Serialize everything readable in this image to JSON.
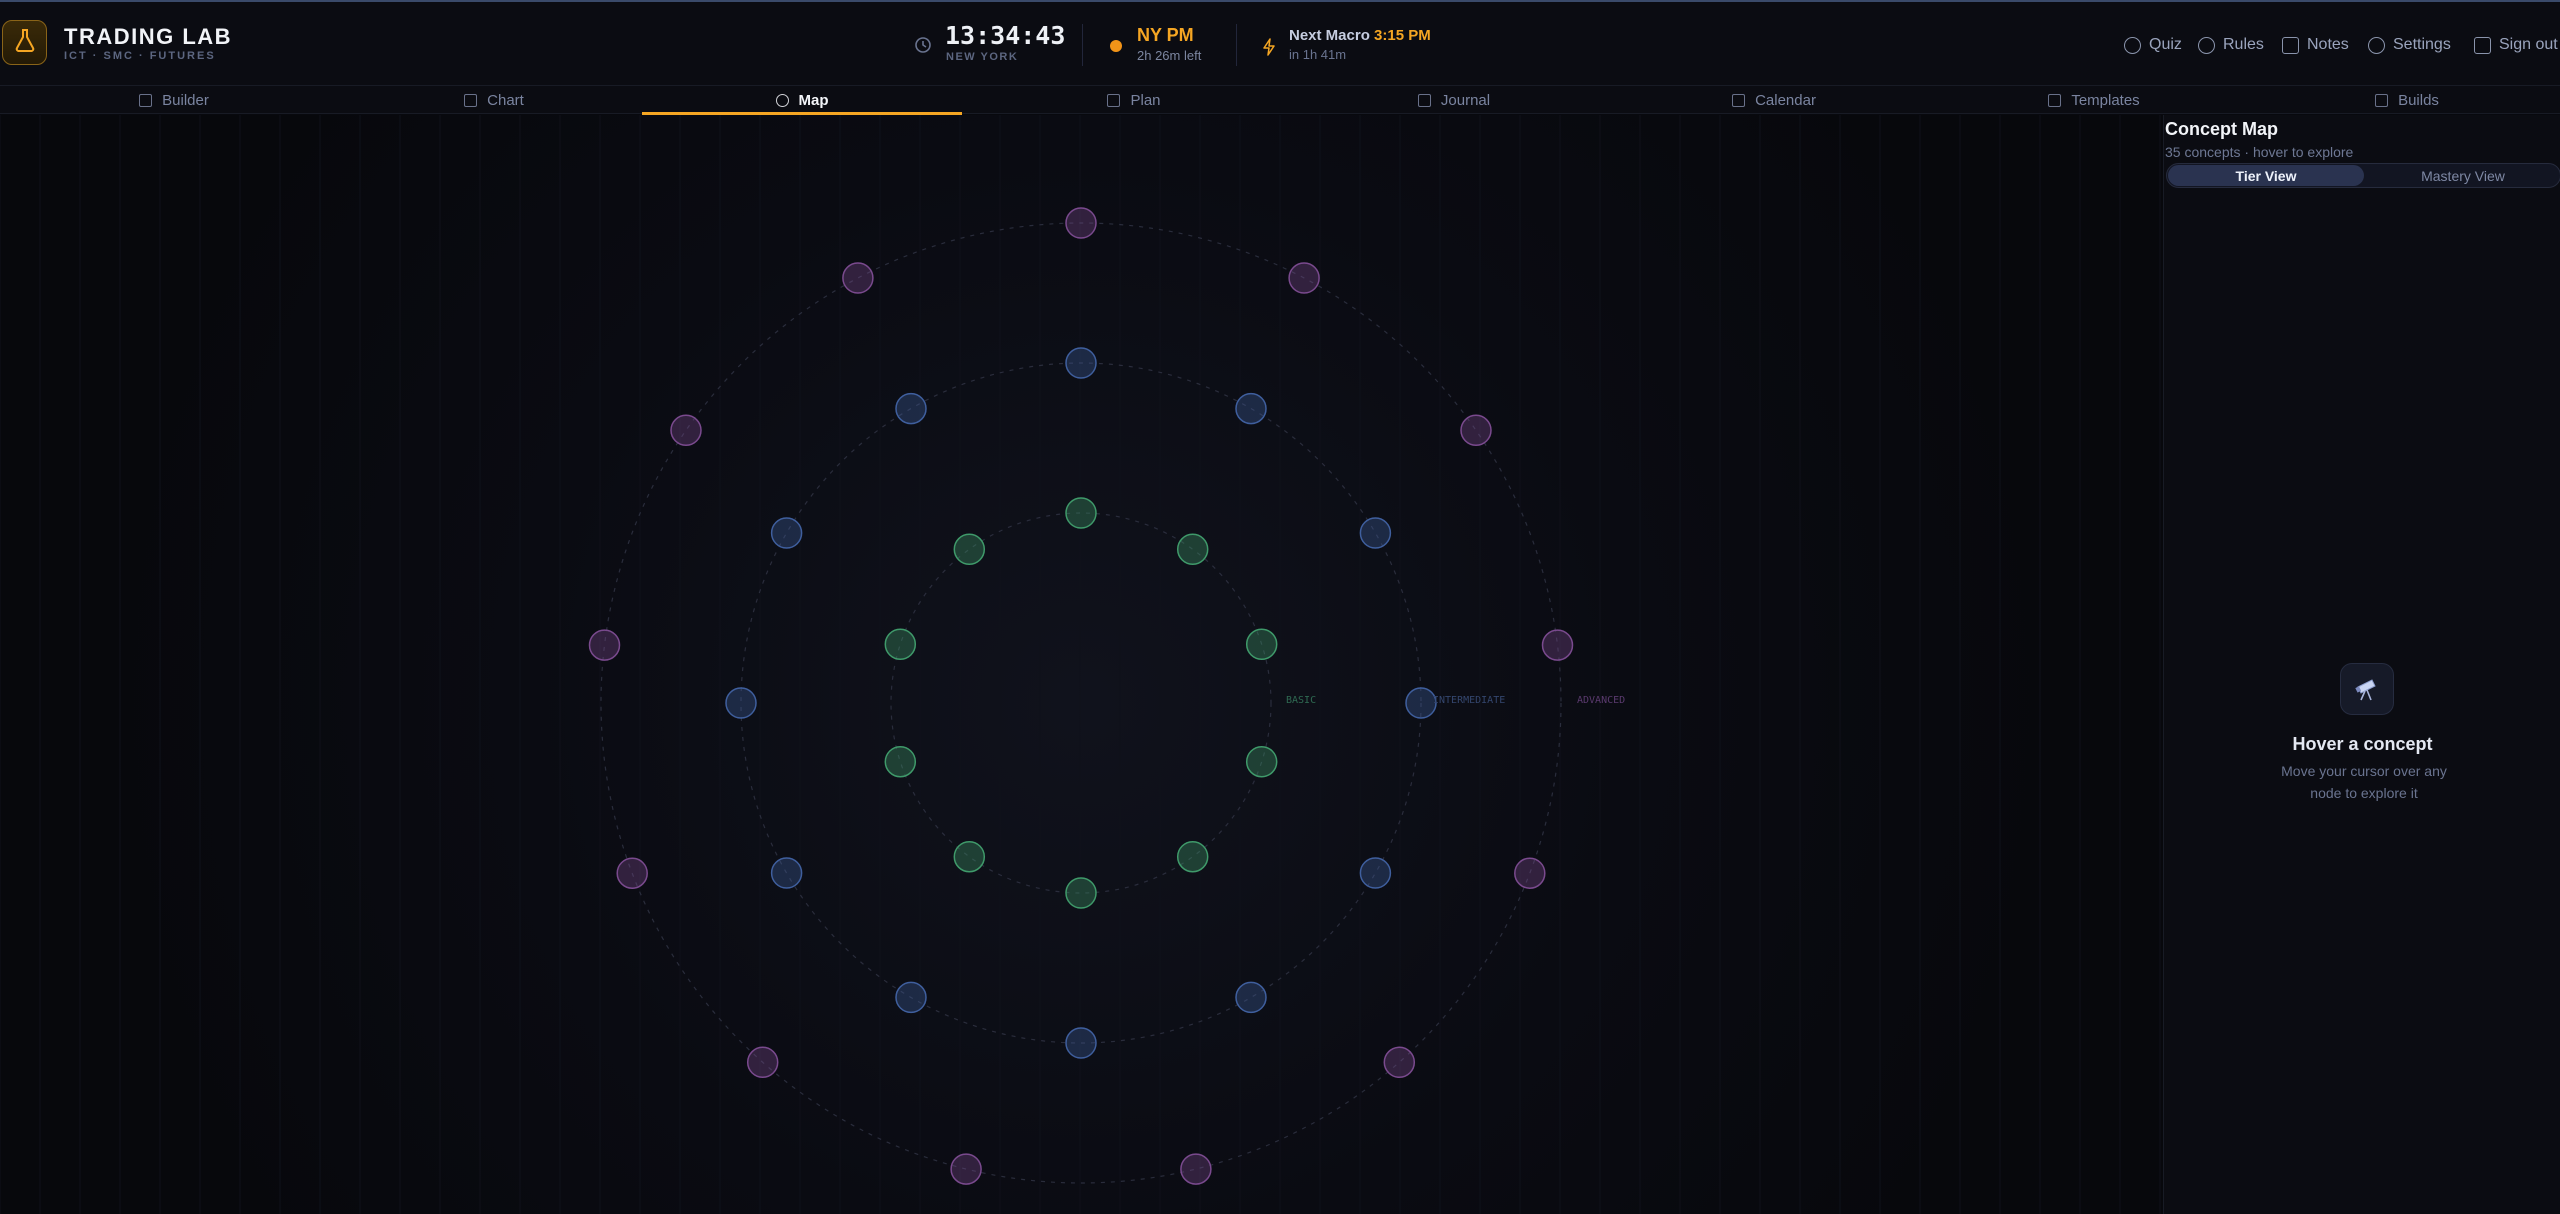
{
  "header": {
    "brand_title": "TRADING LAB",
    "brand_subtitle": "ICT · SMC · FUTURES",
    "clock_time": "13:34:43",
    "clock_zone": "NEW YORK",
    "session_name": "NY PM",
    "session_left": "2h 26m left",
    "macro_label": "Next Macro",
    "macro_time": "3:15 PM",
    "macro_in": "in 1h 41m",
    "buttons": [
      {
        "label": "Quiz",
        "icon": "quiz-icon"
      },
      {
        "label": "Rules",
        "icon": "shield-icon"
      },
      {
        "label": "Notes",
        "icon": "note-icon"
      },
      {
        "label": "Settings",
        "icon": "gear-icon"
      },
      {
        "label": "Sign out",
        "icon": "sign-out-icon"
      }
    ],
    "accent": "#f5a623"
  },
  "nav": {
    "tabs": [
      {
        "label": "Builder",
        "icon": "builder-icon"
      },
      {
        "label": "Chart",
        "icon": "chart-icon"
      },
      {
        "label": "Map",
        "icon": "map-icon",
        "active": true
      },
      {
        "label": "Plan",
        "icon": "plan-icon"
      },
      {
        "label": "Journal",
        "icon": "journal-icon"
      },
      {
        "label": "Calendar",
        "icon": "calendar-icon"
      },
      {
        "label": "Templates",
        "icon": "templates-icon"
      },
      {
        "label": "Builds",
        "icon": "builds-icon"
      }
    ]
  },
  "map": {
    "ring_labels": {
      "basic": "BASIC",
      "intermediate": "INTERMEDIATE",
      "advanced": "ADVANCED"
    },
    "tiers": [
      {
        "name": "basic",
        "count": 10,
        "color": "#3f9a6a"
      },
      {
        "name": "intermediate",
        "count": 12,
        "color": "#3f5f9e"
      },
      {
        "name": "advanced",
        "count": 13,
        "color": "#7a4a8e"
      }
    ]
  },
  "panel": {
    "title": "Concept Map",
    "subtitle": "35 concepts · hover to explore",
    "toggle": {
      "tier": "Tier View",
      "mastery": "Mastery View"
    },
    "empty_icon": "telescope-icon",
    "empty_title": "Hover a concept",
    "empty_desc": "Move your cursor over any node to explore it"
  }
}
